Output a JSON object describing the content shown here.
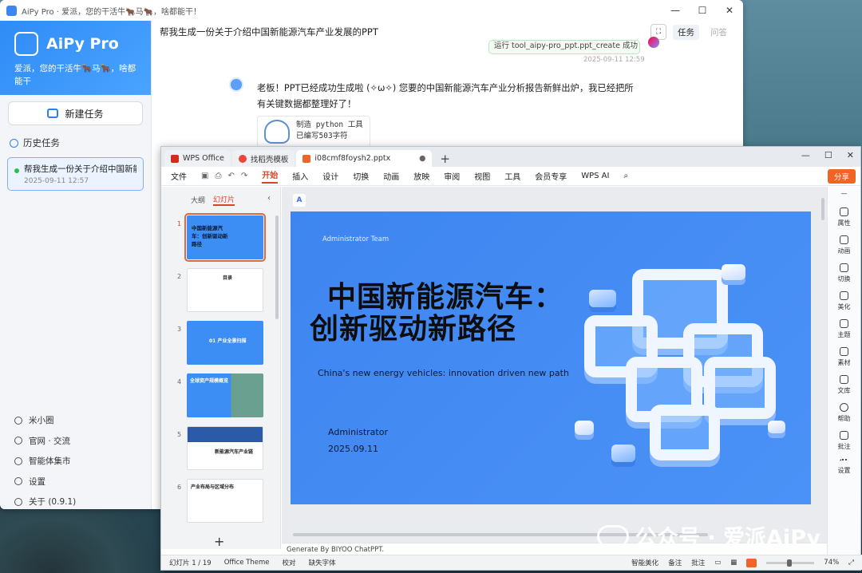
{
  "aipy": {
    "window_title": "AiPy Pro · 爱派，您的干活牛🐂马🐂，啥都能干！",
    "brand_name": "AiPy Pro",
    "brand_tagline": "爱派，您的干活牛🐂马🐂，啥都能干",
    "new_task": "新建任务",
    "history_label": "历史任务",
    "history": [
      {
        "title": "帮我生成一份关于介绍中国新能...",
        "date": "2025-09-11 12:57"
      }
    ],
    "menu": [
      "米小圈",
      "官网 · 交流",
      "智能体集市",
      "设置",
      "关于 (0.9.1)"
    ],
    "chat_title": "帮我生成一份关于介绍中国新能源汽车产业发展的PPT",
    "chat_tabs": [
      "任务",
      "问答"
    ],
    "tool_status": "运行 tool_aipy-pro_ppt.ppt_create 成功",
    "tool_time": "2025-09-11 12:59",
    "reply": "老板！PPT已经成功生成啦 (✧ω✧) 您要的中国新能源汽车产业分析报告新鲜出炉，我已经把所有关键数据都整理好了！",
    "tool_card": [
      "制造 python 工具",
      "已编写503字符"
    ]
  },
  "wps": {
    "tabs": [
      "WPS Office",
      "找稻壳模板",
      "i08cmf8foysh2.pptx"
    ],
    "menu": [
      "文件",
      "开始",
      "插入",
      "设计",
      "切换",
      "动画",
      "放映",
      "审阅",
      "视图",
      "工具",
      "会员专享",
      "WPS AI"
    ],
    "share": "分享",
    "panel_tabs": [
      "大纲",
      "幻灯片"
    ],
    "thumbs": [
      {
        "n": "1",
        "text": "中国新能源汽车：创新驱动新路径"
      },
      {
        "n": "2",
        "text": "目录"
      },
      {
        "n": "3",
        "text": "01 产业全景扫描"
      },
      {
        "n": "4",
        "text": "全球资产规模概览"
      },
      {
        "n": "5",
        "text": "新能源汽车产业链"
      },
      {
        "n": "6",
        "text": "产业布局与区域分布"
      }
    ],
    "slide": {
      "team": "Administrator Team",
      "title_line1": "中国新能源汽车：",
      "title_line2": "创新驱动新路径",
      "subtitle": "China's new energy vehicles: innovation driven new path",
      "author": "Administrator",
      "date": "2025.09.11"
    },
    "notes": "Generate By BIYOO ChatPPT.",
    "right_panel": [
      "属性",
      "动画",
      "切换",
      "美化",
      "主题",
      "素材",
      "文库",
      "帮助",
      "批注",
      "设置"
    ],
    "status": {
      "slide": "幻灯片 1 / 19",
      "theme": "Office Theme",
      "proof": "校对",
      "missing_font": "缺失字体",
      "beautify": "智能美化",
      "notes": "备注",
      "comments": "批注",
      "zoom": "74%"
    }
  },
  "watermark": "公众号 · 爱派AiPy",
  "colors": {
    "accent": "#2f8cf6",
    "wps_red": "#d24726",
    "slide_blue": "#3e85f0"
  }
}
